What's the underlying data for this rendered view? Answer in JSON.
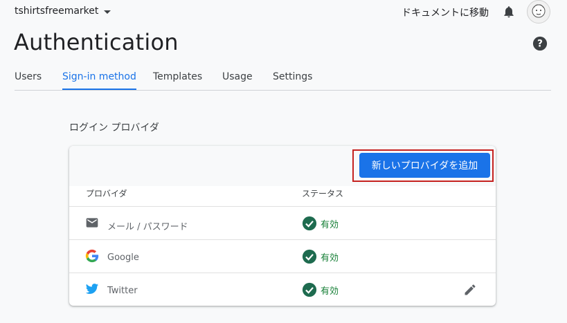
{
  "header": {
    "project_name": "tshirtsfreemarket",
    "docs_link": "ドキュメントに移動",
    "bell_icon": "bell-icon",
    "avatar": "user-avatar"
  },
  "page": {
    "title": "Authentication",
    "help_icon": "help-icon"
  },
  "tabs": [
    {
      "label": "Users",
      "active": false
    },
    {
      "label": "Sign-in method",
      "active": true
    },
    {
      "label": "Templates",
      "active": false
    },
    {
      "label": "Usage",
      "active": false
    },
    {
      "label": "Settings",
      "active": false
    }
  ],
  "providers_section": {
    "title": "ログイン プロバイダ",
    "add_button": "新しいプロバイダを追加",
    "columns": {
      "provider": "プロバイダ",
      "status": "ステータス"
    },
    "rows": [
      {
        "name": "メール / パスワード",
        "icon": "email-icon",
        "status": "有効",
        "editable": false
      },
      {
        "name": "Google",
        "icon": "google-icon",
        "status": "有効",
        "editable": false
      },
      {
        "name": "Twitter",
        "icon": "twitter-icon",
        "status": "有効",
        "editable": true
      }
    ]
  },
  "colors": {
    "accent": "#1a73e8",
    "status_ok": "#188038",
    "highlight": "#c5221f",
    "twitter": "#1da1f2"
  }
}
